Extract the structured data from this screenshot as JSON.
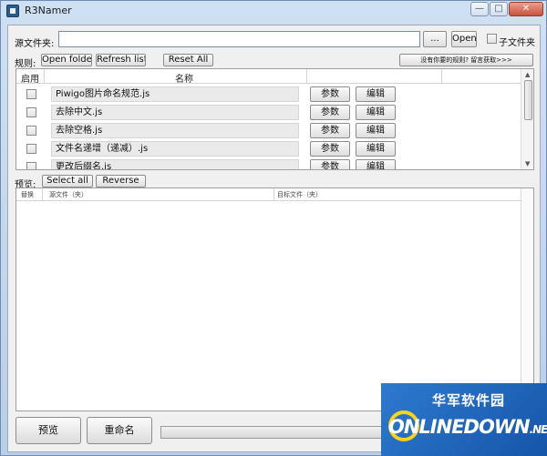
{
  "window": {
    "title": "R3Namer",
    "minimize": "—",
    "maximize": "□",
    "close": "✕"
  },
  "source": {
    "label": "源文件夹:",
    "value": "",
    "browse": "...",
    "open": "Open",
    "subfolder": "子文件夹"
  },
  "rules": {
    "label": "规则:",
    "open_folder": "Open folder",
    "refresh_list": "Refresh list",
    "reset_all": "Reset All",
    "get_more": "没有你要的规则? 留言获取>>>",
    "col_enable": "启用",
    "col_name": "名称",
    "items": [
      {
        "name": "Piwigo图片命名规范.js",
        "params": "参数",
        "edit": "编辑"
      },
      {
        "name": "去除中文.js",
        "params": "参数",
        "edit": "编辑"
      },
      {
        "name": "去除空格.js",
        "params": "参数",
        "edit": "编辑"
      },
      {
        "name": "文件名递增（递减）.js",
        "params": "参数",
        "edit": "编辑"
      },
      {
        "name": "更改后缀名.js",
        "params": "参数",
        "edit": "编辑"
      }
    ]
  },
  "preview": {
    "label": "预览:",
    "select_all": "Select all",
    "reverse": "Reverse",
    "col_replace": "替换",
    "col_source": "源文件（夹）",
    "col_target": "目标文件（夹）"
  },
  "actions": {
    "preview": "预览",
    "rename": "重命名"
  },
  "watermark": {
    "cn": "华军软件园",
    "en": "ONLINEDOWN",
    "suffix": ".NET"
  },
  "colors": {
    "accent": "#2d7ad0",
    "close": "#c8513b",
    "watermark_ring": "#ffd21a"
  }
}
